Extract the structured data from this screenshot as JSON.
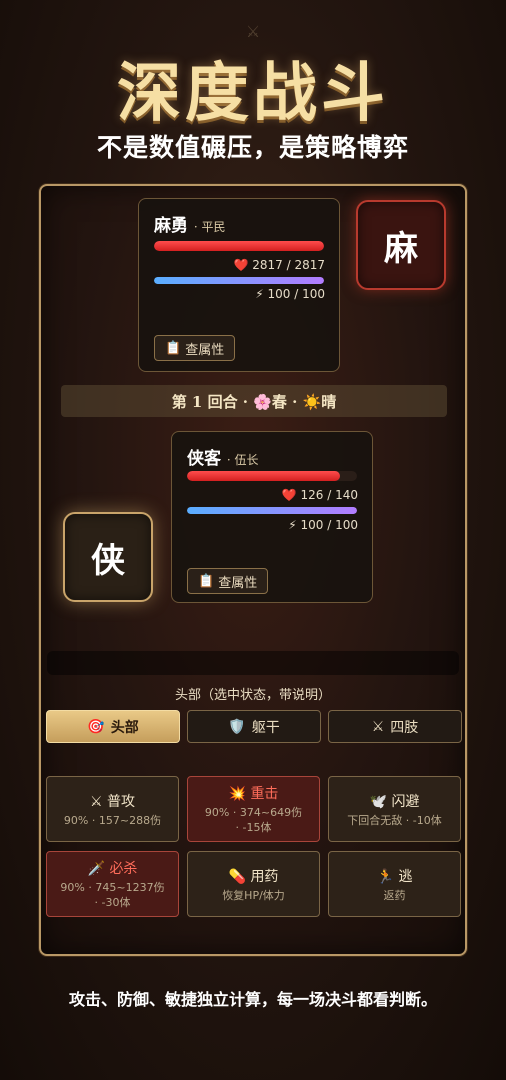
{
  "header": {
    "top_icon": "⚔",
    "title": "深度战斗",
    "subtitle": "不是数值碾压，是策略博弈"
  },
  "enemy": {
    "name": "麻勇",
    "rank": "· 平民",
    "hp_icon": "❤️",
    "hp_text": "2817 / 2817",
    "hp_ratio": 1.0,
    "mp_icon": "⚡",
    "mp_text": "100 / 100",
    "mp_ratio": 1.0,
    "attr_icon": "📋",
    "attr_label": "查属性",
    "avatar_char": "麻"
  },
  "round": {
    "text": "第 1 回合 · 🌸春 · ☀️晴"
  },
  "player": {
    "name": "侠客",
    "rank": "· 伍长",
    "hp_icon": "❤️",
    "hp_text": "126 / 140",
    "hp_ratio": 0.9,
    "mp_icon": "⚡",
    "mp_text": "100 / 100",
    "mp_ratio": 1.0,
    "attr_icon": "📋",
    "attr_label": "查属性",
    "avatar_char": "侠"
  },
  "targets": {
    "label": "头部（选中状态，带说明）",
    "items": [
      {
        "icon": "🎯",
        "label": "头部",
        "active": true
      },
      {
        "icon": "🛡️",
        "label": "躯干",
        "active": false
      },
      {
        "icon": "⚔",
        "label": "四肢",
        "active": false
      }
    ]
  },
  "actions": [
    {
      "icon": "⚔",
      "title": "普攻",
      "desc1": "90% · 157~288伤",
      "desc2": ""
    },
    {
      "icon": "💥",
      "title": "重击",
      "desc1": "90% · 374~649伤",
      "desc2": "· -15体"
    },
    {
      "icon": "🕊️",
      "title": "闪避",
      "desc1": "下回合无敌 · -10体",
      "desc2": ""
    },
    {
      "icon": "🗡️",
      "title": "必杀",
      "desc1": "90% · 745~1237伤",
      "desc2": "· -30体"
    },
    {
      "icon": "💊",
      "title": "用药",
      "desc1": "恢复HP/体力",
      "desc2": ""
    },
    {
      "icon": "🏃",
      "title": "逃",
      "desc1": "返药",
      "desc2": ""
    }
  ],
  "footer": {
    "text": "攻击、防御、敏捷独立计算，每一场决斗都看判断。"
  }
}
